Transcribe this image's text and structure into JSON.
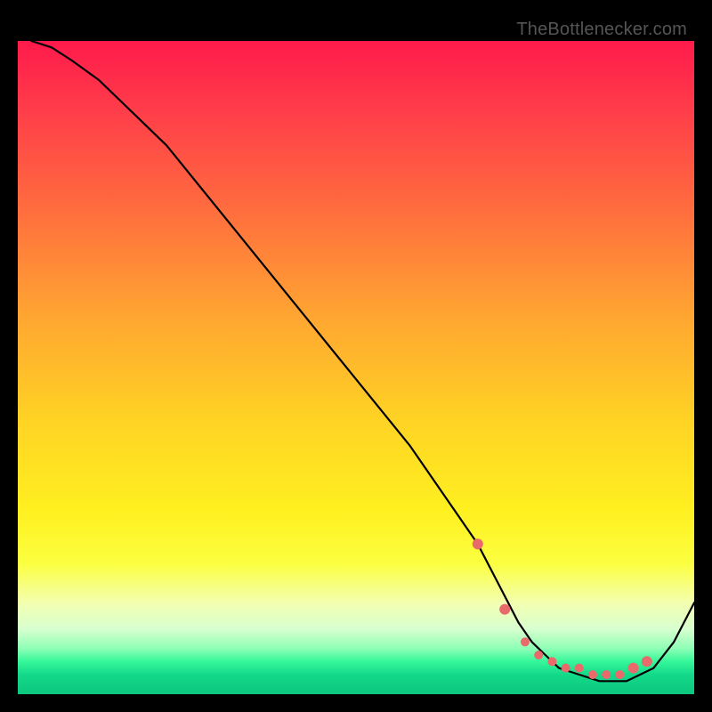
{
  "watermark_text": "TheBottlenecker.com",
  "chart_data": {
    "type": "line",
    "title": "",
    "xlabel": "",
    "ylabel": "",
    "xlim": [
      0,
      100
    ],
    "ylim": [
      0,
      100
    ],
    "series": [
      {
        "name": "bottleneck-curve",
        "x": [
          2,
          5,
          8,
          12,
          22,
          40,
          58,
          68,
          72,
          74,
          76,
          78,
          80,
          83,
          86,
          88,
          90,
          92,
          94,
          97,
          100
        ],
        "values": [
          100,
          99,
          97,
          94,
          84,
          61,
          38,
          23,
          15,
          11,
          8,
          6,
          4,
          3,
          2,
          2,
          2,
          3,
          4,
          8,
          14
        ]
      }
    ],
    "markers": {
      "name": "highlight-dots",
      "x": [
        68,
        72,
        75,
        77,
        79,
        81,
        83,
        85,
        87,
        89,
        91,
        93
      ],
      "values": [
        23,
        13,
        8,
        6,
        5,
        4,
        4,
        3,
        3,
        3,
        4,
        5
      ]
    },
    "background_gradient": {
      "top": "#ff1a4b",
      "mid": "#ffe63a",
      "bottom": "#0cc77f"
    }
  }
}
